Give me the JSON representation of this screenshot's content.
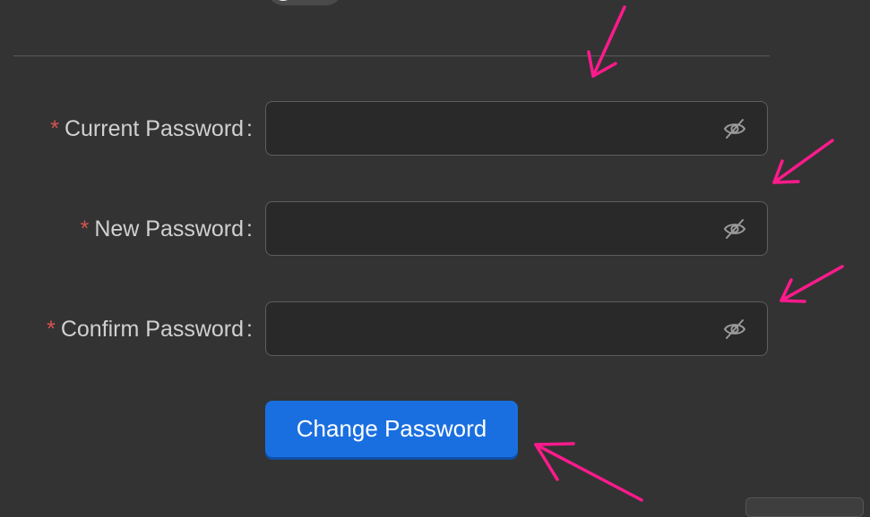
{
  "form": {
    "fields": [
      {
        "label": "Current Password",
        "required_mark": "*",
        "colon": ":",
        "value": "",
        "placeholder": "",
        "toggle_icon": "eye-off-icon"
      },
      {
        "label": "New Password",
        "required_mark": "*",
        "colon": ":",
        "value": "",
        "placeholder": "",
        "toggle_icon": "eye-off-icon"
      },
      {
        "label": "Confirm Password",
        "required_mark": "*",
        "colon": ":",
        "value": "",
        "placeholder": "",
        "toggle_icon": "eye-off-icon"
      }
    ],
    "submit_label": "Change Password"
  },
  "colors": {
    "background": "#333333",
    "field_background": "#292929",
    "field_border": "#5d5d5d",
    "label_text": "#d0d0d0",
    "required_mark": "#d9534f",
    "primary_button": "#1a6fe0",
    "annotation_arrow": "#ff1a8c"
  }
}
